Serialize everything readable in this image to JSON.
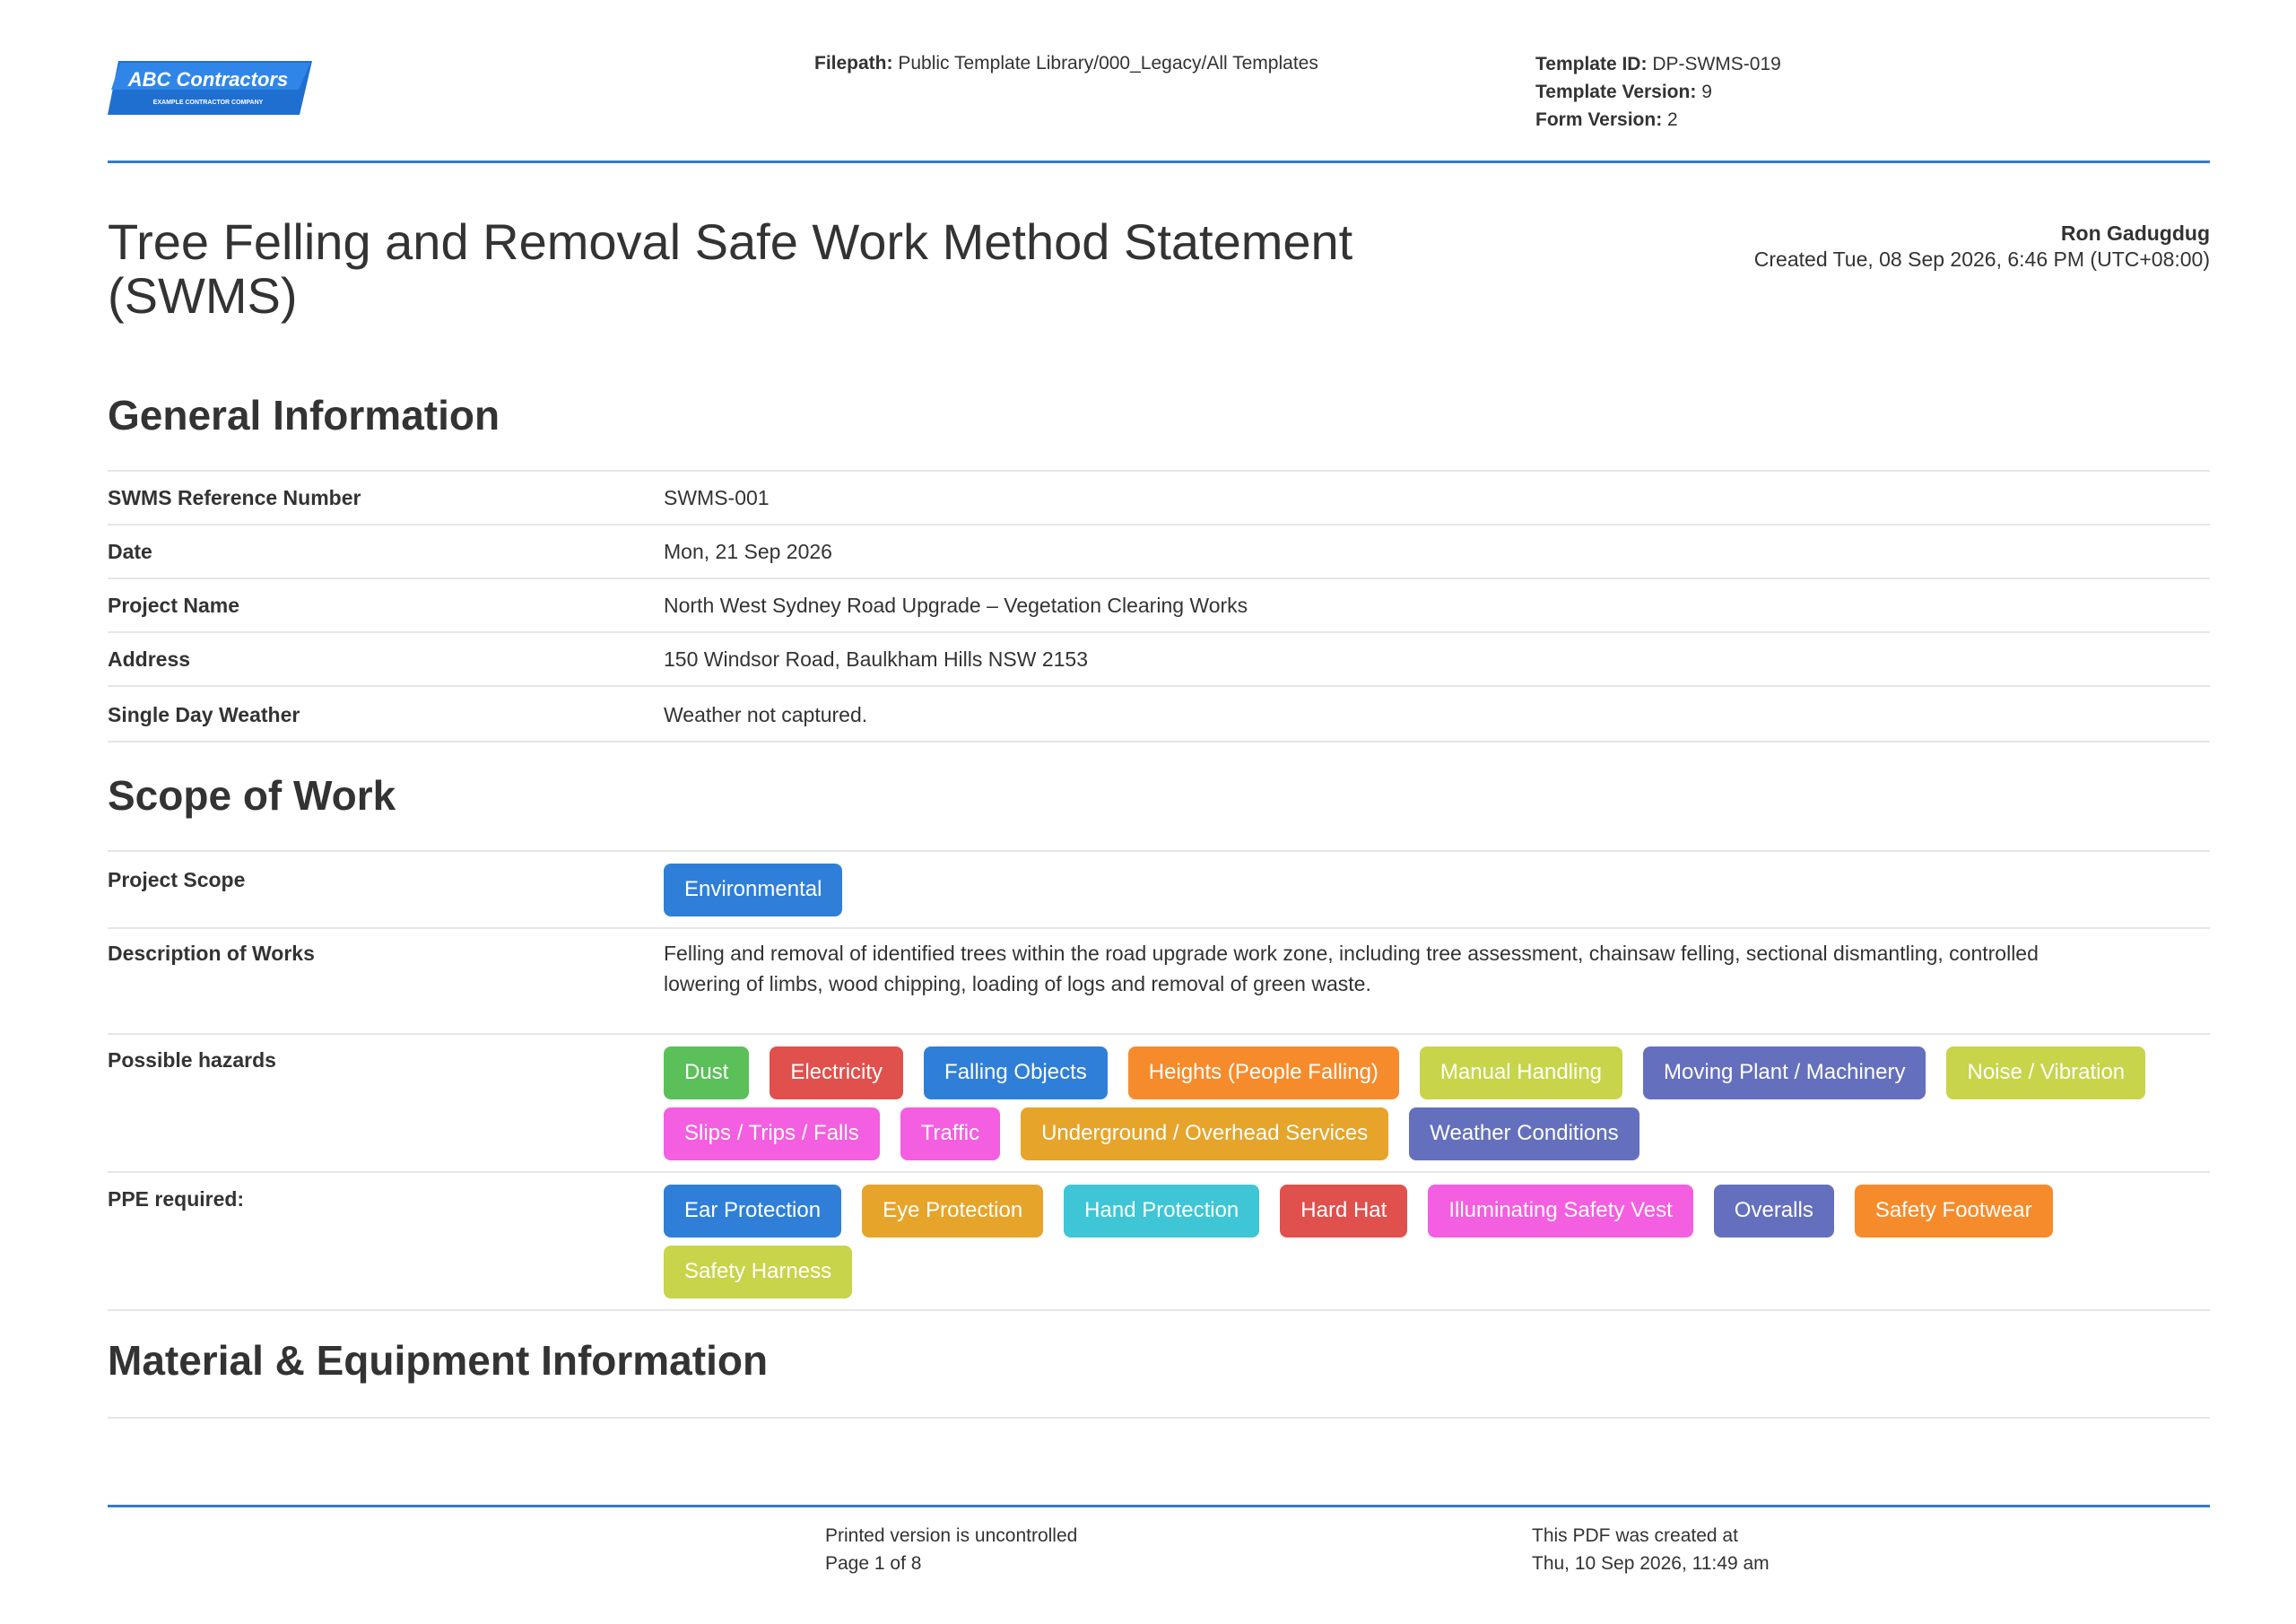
{
  "header": {
    "logo_text": "ABC Contractors",
    "logo_subtext": "EXAMPLE CONTRACTOR COMPANY",
    "filepath_label": "Filepath:",
    "filepath_value": "Public Template Library/000_Legacy/All Templates",
    "template_id_label": "Template ID:",
    "template_id_value": "DP-SWMS-019",
    "template_version_label": "Template Version:",
    "template_version_value": "9",
    "form_version_label": "Form Version:",
    "form_version_value": "2"
  },
  "title": {
    "line1": "Tree Felling and Removal Safe Work Method Statement",
    "line2": "(SWMS)"
  },
  "author": {
    "name": "Ron Gadugdug",
    "created": "Created Tue, 08 Sep 2026, 6:46 PM (UTC+08:00)"
  },
  "general": {
    "heading": "General Information",
    "rows": [
      {
        "label": "SWMS Reference Number",
        "value": "SWMS-001"
      },
      {
        "label": "Date",
        "value": "Mon, 21 Sep 2026"
      },
      {
        "label": "Project Name",
        "value": "North West Sydney Road Upgrade – Vegetation Clearing Works"
      },
      {
        "label": "Address",
        "value": "150 Windsor Road, Baulkham Hills NSW 2153"
      },
      {
        "label": "Single Day Weather",
        "value": "Weather not captured."
      }
    ]
  },
  "scope": {
    "heading": "Scope of Work",
    "project_scope_label": "Project Scope",
    "project_scope_chips": [
      {
        "label": "Environmental",
        "color": "#2f7fd8"
      }
    ],
    "description_label": "Description of Works",
    "description_line1": "Felling and removal of identified trees within the road upgrade work zone, including tree assessment, chainsaw felling, sectional dismantling, controlled",
    "description_line2": "lowering of limbs, wood chipping, loading of logs and removal of green waste.",
    "hazards_label": "Possible hazards",
    "hazards": [
      {
        "label": "Dust",
        "color": "#5bbf5a"
      },
      {
        "label": "Electricity",
        "color": "#e0504c"
      },
      {
        "label": "Falling Objects",
        "color": "#2f7fd8"
      },
      {
        "label": "Heights (People Falling)",
        "color": "#f68b2c"
      },
      {
        "label": "Manual Handling",
        "color": "#c8d44a"
      },
      {
        "label": "Moving Plant / Machinery",
        "color": "#6470bd"
      },
      {
        "label": "Noise / Vibration",
        "color": "#c8d44a"
      },
      {
        "label": "Slips / Trips / Falls",
        "color": "#f45ee0"
      },
      {
        "label": "Traffic",
        "color": "#f45ee0"
      },
      {
        "label": "Underground / Overhead Services",
        "color": "#e6a42a"
      },
      {
        "label": "Weather Conditions",
        "color": "#6470bd"
      }
    ],
    "ppe_label": "PPE required:",
    "ppe": [
      {
        "label": "Ear Protection",
        "color": "#2f7fd8"
      },
      {
        "label": "Eye Protection",
        "color": "#e6a42a"
      },
      {
        "label": "Hand Protection",
        "color": "#3ec6d6"
      },
      {
        "label": "Hard Hat",
        "color": "#e0504c"
      },
      {
        "label": "Illuminating Safety Vest",
        "color": "#f45ee0"
      },
      {
        "label": "Overalls",
        "color": "#6470bd"
      },
      {
        "label": "Safety Footwear",
        "color": "#f68b2c"
      },
      {
        "label": "Safety Harness",
        "color": "#c8d44a"
      }
    ]
  },
  "material": {
    "heading": "Material & Equipment Information"
  },
  "footer": {
    "uncontrolled": "Printed version is uncontrolled",
    "page": "Page 1 of 8",
    "created_label": "This PDF was created at",
    "created_value": "Thu, 10 Sep 2026, 11:49 am"
  }
}
